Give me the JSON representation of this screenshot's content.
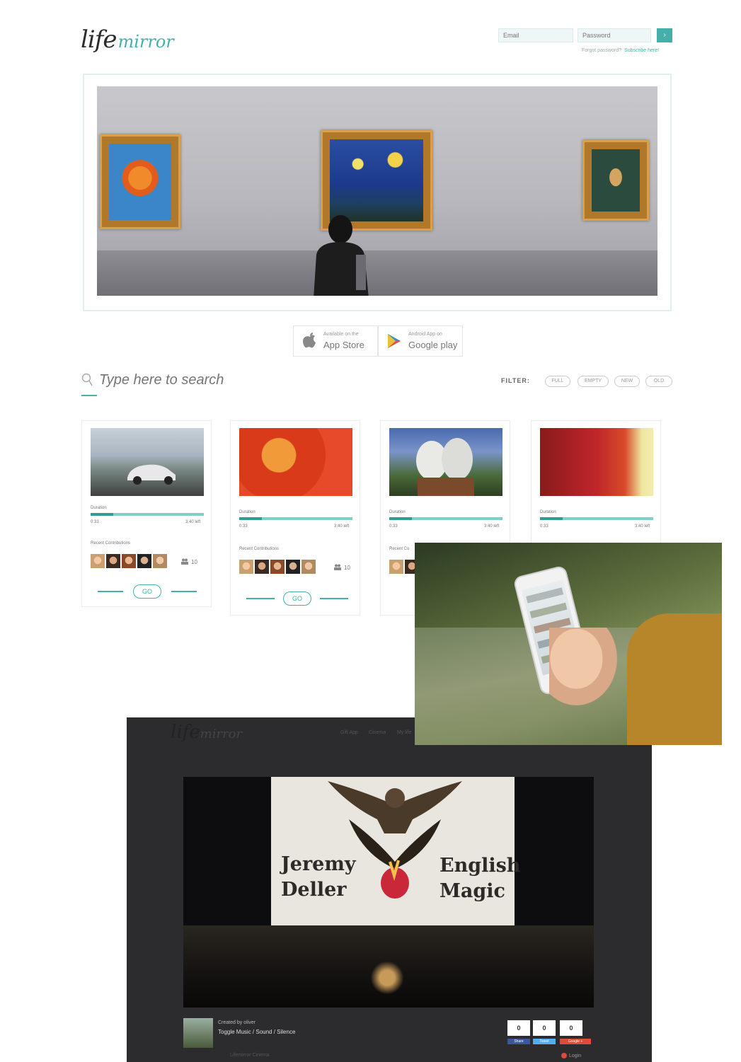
{
  "header": {
    "logo_life": "life",
    "logo_mirror": "mirror",
    "email_placeholder": "Email",
    "password_placeholder": "Password",
    "login_label": "›",
    "forgot_text": "Forgot password?",
    "forgot_link": "Subscribe here!"
  },
  "apps": {
    "appstore_small": "Available on the",
    "appstore_big": "App Store",
    "google_small": "Android App on",
    "google_big": "Google play"
  },
  "search": {
    "placeholder": "Type here to search"
  },
  "filter": {
    "label": "FILTER:",
    "chips": [
      "FULL",
      "EMPTY",
      "NEW",
      "OLD"
    ]
  },
  "cards": [
    {
      "duration_label": "Duration",
      "start": "0:33",
      "end": "3:40 left",
      "recent_label": "Recent Contributions",
      "count": "10",
      "go": "GO",
      "progress": 0.2
    },
    {
      "duration_label": "Duration",
      "start": "0:33",
      "end": "3:40 left",
      "recent_label": "Recent Contributions",
      "count": "10",
      "go": "GO",
      "progress": 0.2
    },
    {
      "duration_label": "Duration",
      "start": "0:33",
      "end": "3:40 left",
      "recent_label": "Recent Co",
      "progress": 0.2
    },
    {
      "duration_label": "Duration",
      "start": "0:33",
      "end": "3:40 left",
      "progress": 0.2
    }
  ],
  "cinema": {
    "logo_life": "life",
    "logo_mirror": "mirror",
    "nav": [
      "Gift App",
      "Cinema",
      "My life"
    ],
    "screen_left": "Jeremy\nDeller",
    "screen_right": "English\nMagic",
    "created_by": "Created by oliver",
    "toggle": "Toggle Music / Sound / Silence",
    "share_counts": [
      "0",
      "0",
      "0"
    ],
    "share_labels": [
      "Share",
      "Tweet",
      "Google +"
    ],
    "footer": "Lifemirror Cinema",
    "login": "Login"
  },
  "colors": {
    "accent": "#45b0aa",
    "dark_bg": "#2c2c2e"
  }
}
